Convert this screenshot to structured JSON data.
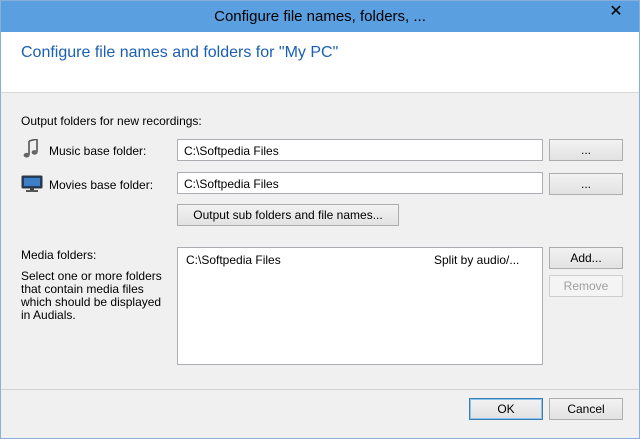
{
  "window": {
    "title": "Configure file names, folders, ...",
    "close_label": "✕"
  },
  "header": {
    "heading": "Configure file names and folders for \"My PC\""
  },
  "output": {
    "section_label": "Output folders for new recordings:",
    "music": {
      "label": "Music base folder:",
      "value": "C:\\Softpedia Files",
      "browse_label": "...",
      "icon": "music-note-icon"
    },
    "movies": {
      "label": "Movies base folder:",
      "value": "C:\\Softpedia Files",
      "browse_label": "...",
      "icon": "monitor-icon"
    },
    "subfolders_button": "Output sub folders and file names..."
  },
  "media": {
    "label": "Media folders:",
    "description": "Select one or more folders that contain media files which should be displayed in Audials.",
    "rows": [
      {
        "path": "C:\\Softpedia Files",
        "mode": "Split by audio/..."
      }
    ],
    "add_label": "Add...",
    "remove_label": "Remove"
  },
  "footer": {
    "ok_label": "OK",
    "cancel_label": "Cancel"
  }
}
